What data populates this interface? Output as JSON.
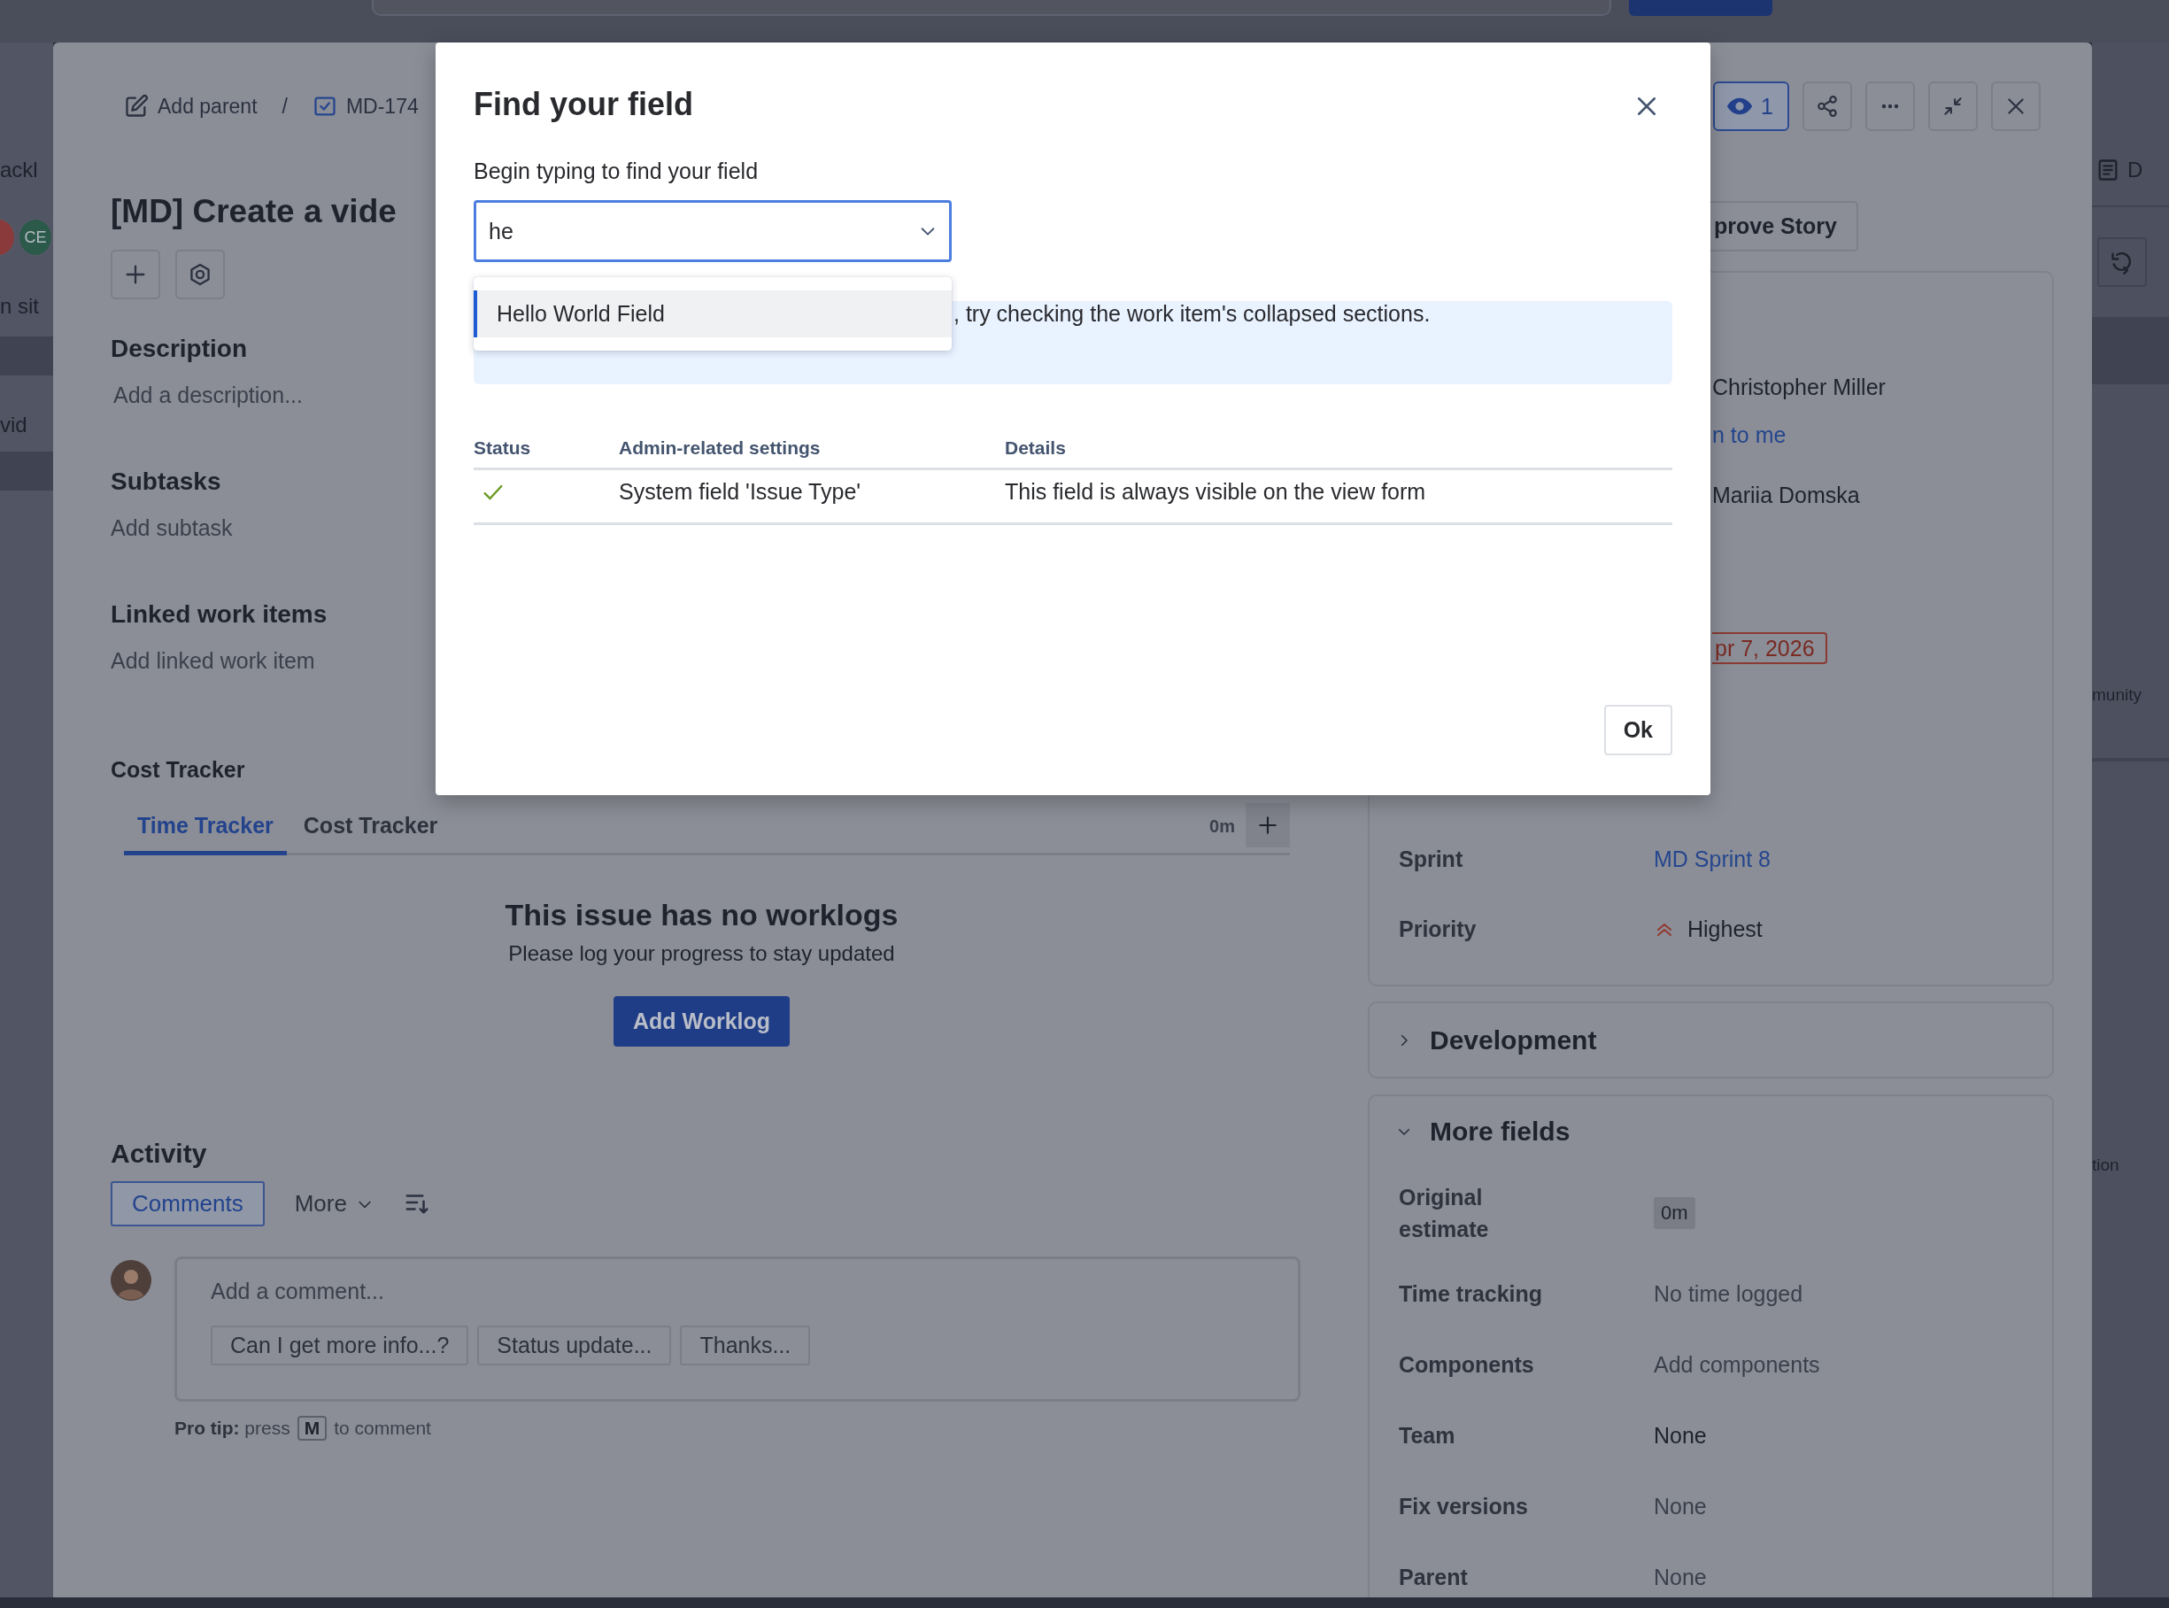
{
  "background": {
    "left_texts": [
      "ackl",
      "n sit",
      "vid"
    ],
    "avatars": [
      {
        "color": "#8a3a3a"
      },
      {
        "initials": "CE",
        "color": "#2b5a4a"
      }
    ],
    "right_tab": "D",
    "right_texts": [
      "munity",
      "tion"
    ]
  },
  "issue": {
    "breadcrumb": [
      {
        "kind": "parent",
        "label": "Add parent"
      },
      {
        "kind": "issue",
        "label": "MD-174"
      }
    ],
    "separator": "/",
    "title": "[MD] Create a vide",
    "watchers": "1",
    "sections": [
      {
        "title": "Description",
        "action": "Add a description..."
      },
      {
        "title": "Subtasks",
        "action": "Add subtask"
      },
      {
        "title": "Linked work items",
        "action": "Add linked work item"
      }
    ],
    "cost_tracker": {
      "title": "Cost Tracker",
      "tabs": [
        {
          "label": "Time Tracker",
          "selected": true
        },
        {
          "label": "Cost Tracker",
          "selected": false
        }
      ],
      "total": "0m",
      "empty_title": "This issue has no worklogs",
      "empty_text": "Please log your progress to stay updated",
      "button": "Add Worklog"
    },
    "activity": {
      "title": "Activity",
      "tabs": [
        {
          "label": "Comments",
          "selected": true
        },
        {
          "label": "More",
          "selected": false
        }
      ],
      "comment_placeholder": "Add a comment...",
      "suggestions": [
        "Can I get more info...?",
        "Status update...",
        "Thanks..."
      ],
      "pro_tip": "**Pro tip:** press",
      "shortcut": "M",
      "pro_tip_end": "to comment"
    }
  },
  "sidebar": {
    "transition_button": "prove Story",
    "details": [
      {
        "kind": "text",
        "value": "Christopher Miller"
      },
      {
        "kind": "link",
        "value": "n to me"
      },
      {
        "kind": "text",
        "value": "Mariia Domska"
      },
      {
        "kind": "due",
        "value": "pr 7, 2026"
      }
    ],
    "fields": [
      {
        "kind": "link",
        "label": "Sprint",
        "value": "MD Sprint 8"
      },
      {
        "kind": "priority",
        "label": "Priority",
        "value": "Highest"
      }
    ],
    "development": {
      "title": "Development",
      "expanded": false
    },
    "more_fields": {
      "title": "More fields",
      "expanded": true,
      "fields": [
        {
          "kind": "tag",
          "label": "Original estimate",
          "value": "0m"
        },
        {
          "kind": "muted",
          "label": "Time tracking",
          "value": "No time logged"
        },
        {
          "kind": "muted",
          "label": "Components",
          "value": "Add components"
        },
        {
          "kind": "text",
          "label": "Team",
          "value": "None"
        },
        {
          "kind": "muted",
          "label": "Fix versions",
          "value": "None"
        },
        {
          "kind": "muted",
          "label": "Parent",
          "value": "None"
        }
      ]
    }
  },
  "modal": {
    "title": "Find your field",
    "label": "Begin typing to find your field",
    "value": "he",
    "options": [
      {
        "label": "Hello World Field",
        "selected": true
      }
    ],
    "banner": ", try checking the work item's collapsed sections.",
    "table": {
      "columns": [
        "Status",
        "Admin-related settings",
        "Details"
      ],
      "rows": [
        {
          "passed": true,
          "setting": "System field 'Issue Type'",
          "details": "This field is always visible on the view form"
        }
      ]
    },
    "ok_button": "Ok"
  }
}
